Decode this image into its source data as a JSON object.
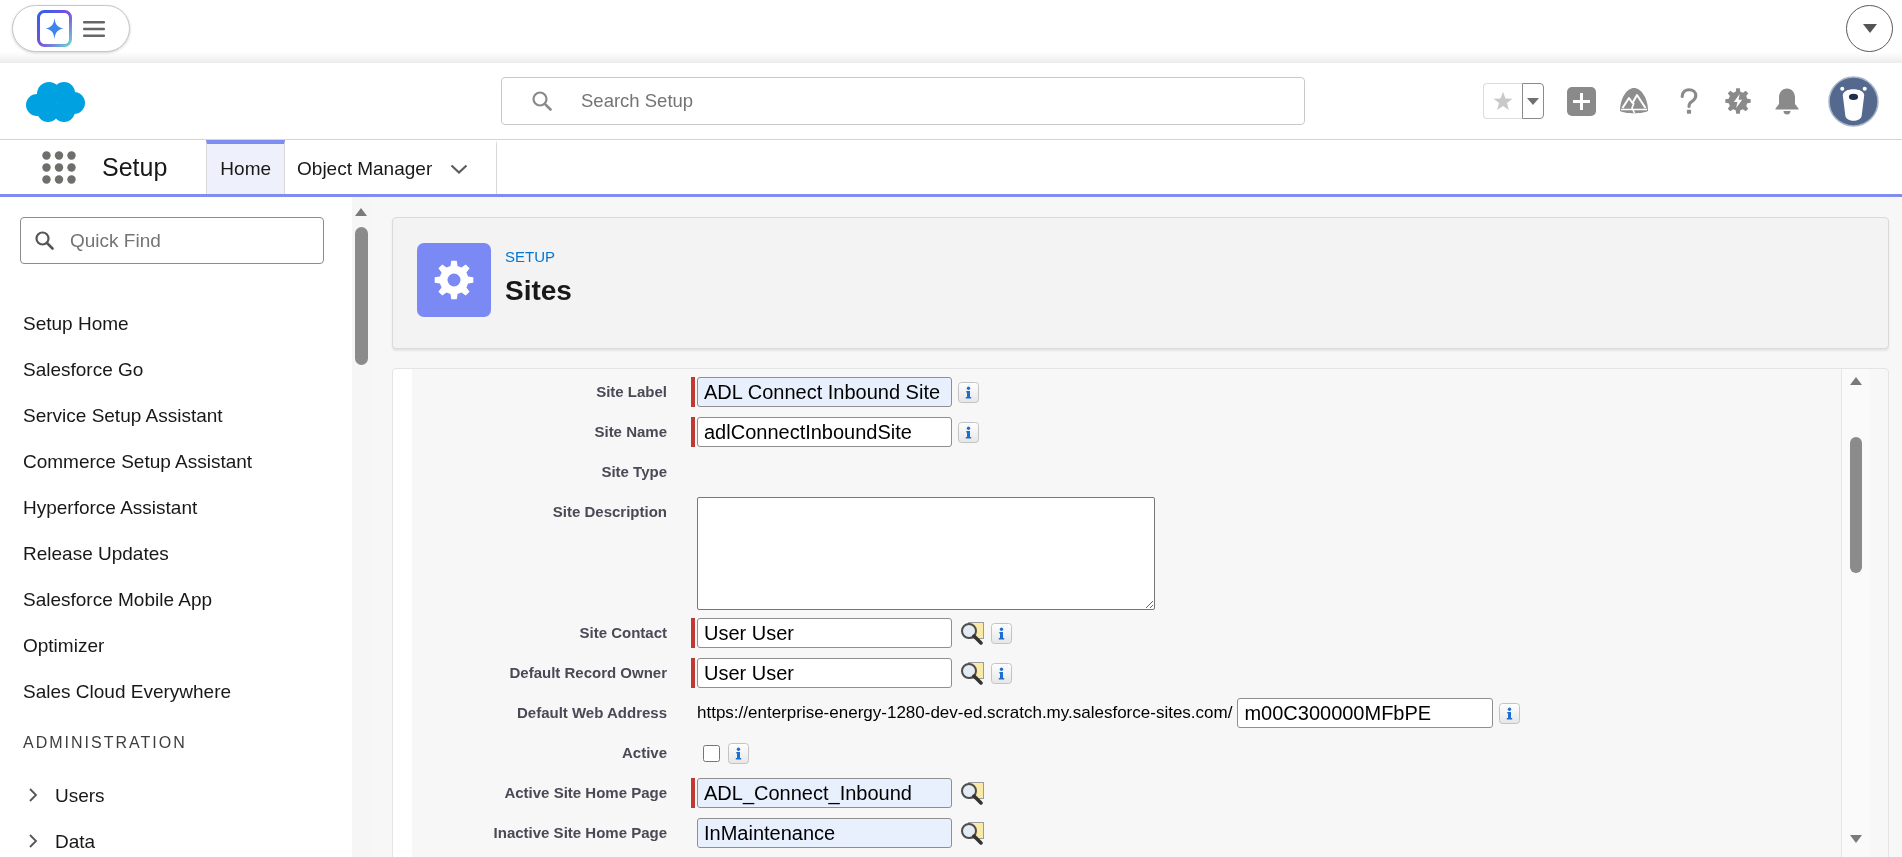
{
  "header": {
    "search": {
      "placeholder": "Search Setup"
    }
  },
  "nav": {
    "app_name": "Setup",
    "tabs": [
      {
        "label": "Home",
        "selected": true,
        "dropdown": false
      },
      {
        "label": "Object Manager",
        "selected": false,
        "dropdown": true
      }
    ]
  },
  "sidebar": {
    "search": {
      "placeholder": "Quick Find"
    },
    "items": [
      {
        "label": "Setup Home"
      },
      {
        "label": "Salesforce Go"
      },
      {
        "label": "Service Setup Assistant"
      },
      {
        "label": "Commerce Setup Assistant"
      },
      {
        "label": "Hyperforce Assistant"
      },
      {
        "label": "Release Updates"
      },
      {
        "label": "Salesforce Mobile App"
      },
      {
        "label": "Optimizer"
      },
      {
        "label": "Sales Cloud Everywhere"
      }
    ],
    "sections": [
      {
        "title": "ADMINISTRATION",
        "items": [
          {
            "label": "Users",
            "expanded": false
          },
          {
            "label": "Data",
            "expanded": false
          }
        ]
      }
    ]
  },
  "page_header": {
    "eyebrow": "SETUP",
    "title": "Sites"
  },
  "form": {
    "fields": [
      {
        "label": "Site Label",
        "kind": "text",
        "value": "ADL Connect Inbound Site",
        "required": true,
        "autofilled": true,
        "info": true
      },
      {
        "label": "Site Name",
        "kind": "text",
        "value": "adlConnectInboundSite",
        "required": true,
        "autofilled": false,
        "info": true
      },
      {
        "label": "Site Type",
        "kind": "readonly",
        "required": false,
        "info": false
      },
      {
        "label": "Site Description",
        "kind": "textarea",
        "required": false,
        "autofilled": false,
        "info": false
      },
      {
        "label": "Site Contact",
        "kind": "lookup",
        "value": "User User",
        "required": true,
        "autofilled": false,
        "info": true
      },
      {
        "label": "Default Record Owner",
        "kind": "lookup",
        "value": "User User",
        "required": true,
        "autofilled": false,
        "info": true
      },
      {
        "label": "Default Web Address",
        "kind": "url",
        "prefix": "https://enterprise-energy-1280-dev-ed.scratch.my.salesforce-sites.com/",
        "value": "m00C300000MFbPE",
        "required": false,
        "autofilled": false,
        "info": true
      },
      {
        "label": "Active",
        "kind": "checkbox",
        "checked": false,
        "required": false,
        "info": true
      },
      {
        "label": "Active Site Home Page",
        "kind": "lookup",
        "value": "ADL_Connect_Inbound",
        "required": true,
        "autofilled": true,
        "info": false
      },
      {
        "label": "Inactive Site Home Page",
        "kind": "lookup",
        "value": "InMaintenance",
        "required": false,
        "autofilled": true,
        "info": false
      }
    ]
  }
}
